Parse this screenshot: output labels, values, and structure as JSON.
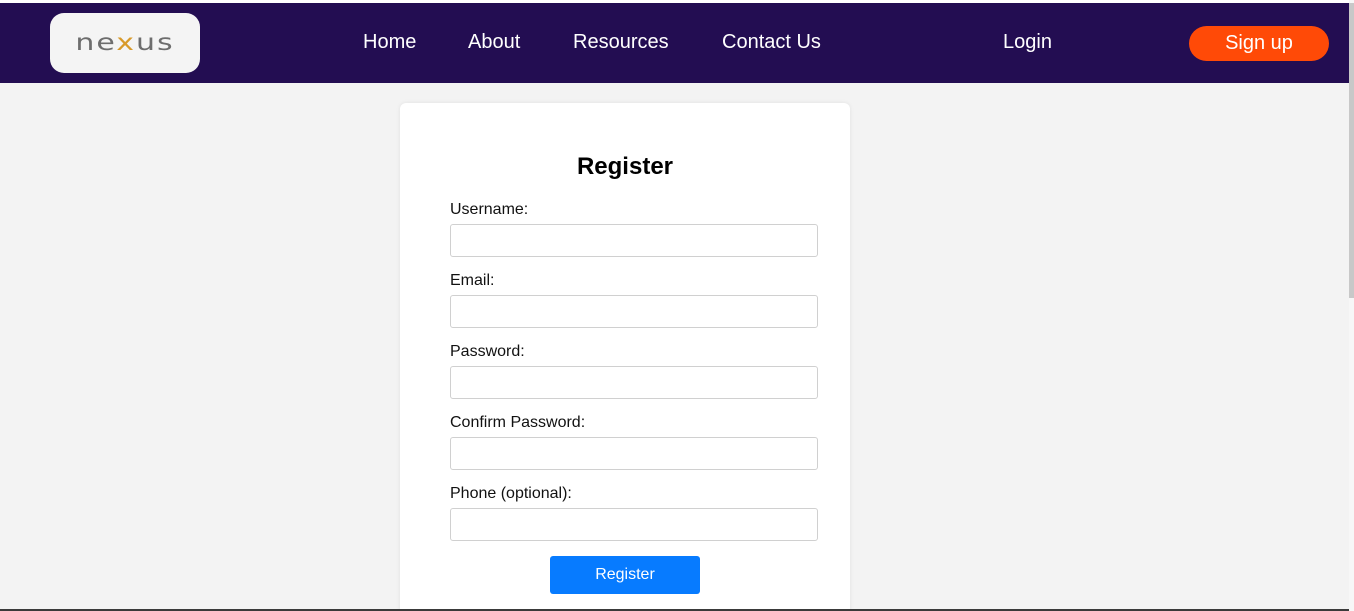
{
  "header": {
    "logo_text_prefix": "ne",
    "logo_text_x": "x",
    "logo_text_suffix": "us",
    "nav_items": [
      "Home",
      "About",
      "Resources",
      "Contact Us"
    ],
    "login_label": "Login",
    "signup_label": "Sign up"
  },
  "form": {
    "title": "Register",
    "fields": [
      {
        "label": "Username:",
        "value": "",
        "placeholder": ""
      },
      {
        "label": "Email:",
        "value": "",
        "placeholder": ""
      },
      {
        "label": "Password:",
        "value": "",
        "placeholder": ""
      },
      {
        "label": "Confirm Password:",
        "value": "",
        "placeholder": ""
      },
      {
        "label": "Phone (optional):",
        "value": "",
        "placeholder": ""
      }
    ],
    "submit_label": "Register"
  },
  "colors": {
    "navbar": "#230d52",
    "signup_button": "#ff4a07",
    "register_button": "#077bff",
    "page_background": "#f3f3f3"
  }
}
